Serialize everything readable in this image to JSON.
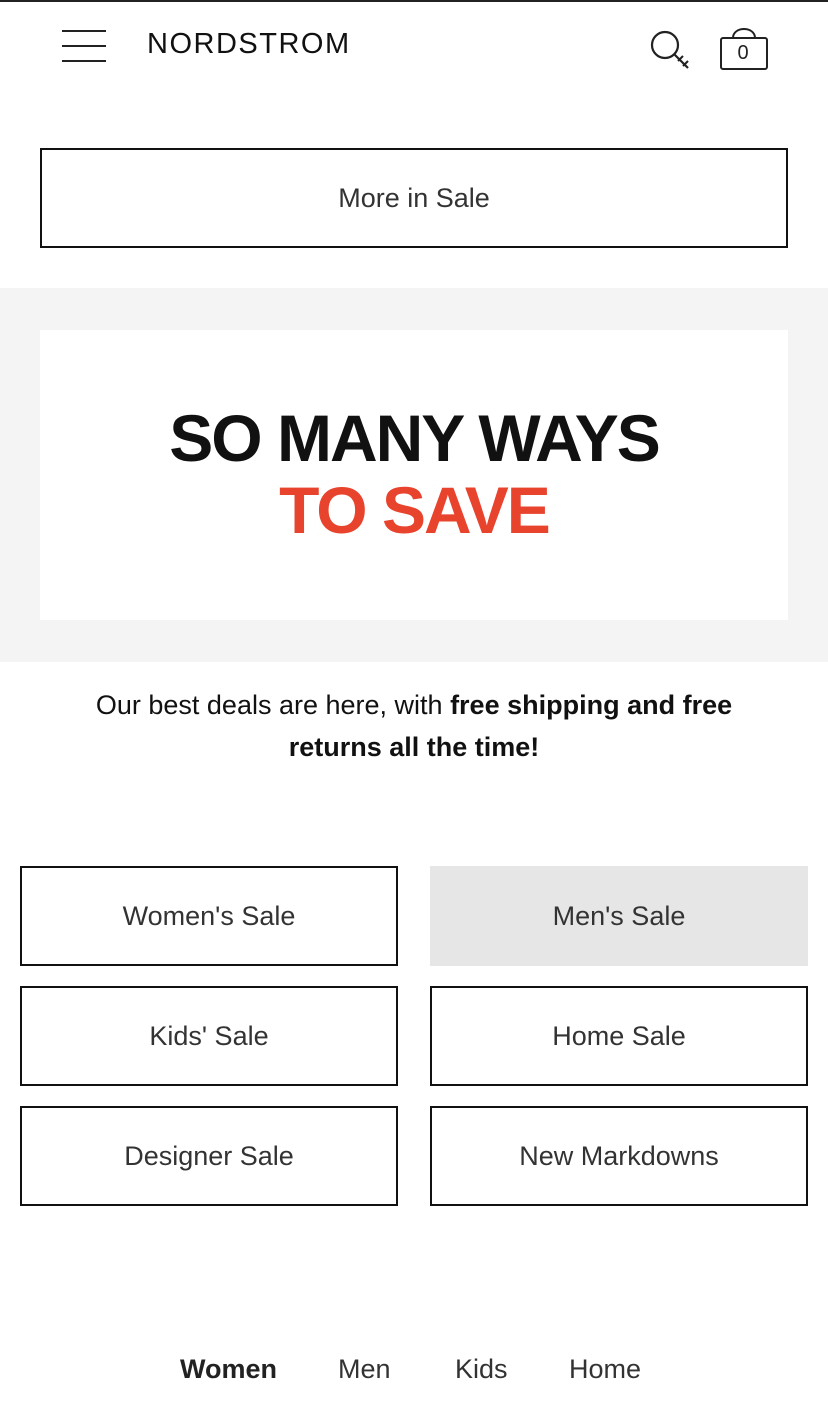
{
  "header": {
    "logo": "NORDSTROM",
    "bag_count": "0",
    "icons": [
      "hamburger-menu-icon",
      "search-icon",
      "shopping-bag-icon"
    ]
  },
  "more_button": {
    "label": "More in Sale"
  },
  "banner": {
    "line1": "SO MANY WAYS",
    "line2": "TO SAVE",
    "line1_color": "#111111",
    "line2_color": "#e8432d"
  },
  "promo": {
    "text_regular": "Our best deals are here, with ",
    "text_bold": "free shipping and free returns all the time!"
  },
  "categories": [
    {
      "label": "Women's Sale",
      "selected": false
    },
    {
      "label": "Men's Sale",
      "selected": true
    },
    {
      "label": "Kids' Sale",
      "selected": false
    },
    {
      "label": "Home Sale",
      "selected": false
    },
    {
      "label": "Designer Sale",
      "selected": false
    },
    {
      "label": "New Markdowns",
      "selected": false
    }
  ],
  "bottom_nav": [
    {
      "label": "Women",
      "active": true
    },
    {
      "label": "Men",
      "active": false
    },
    {
      "label": "Kids",
      "active": false
    },
    {
      "label": "Home",
      "active": false
    }
  ],
  "colors": {
    "accent_red": "#e8432d",
    "banner_background": "#f4f4f4",
    "selected_button_background": "#e6e6e6"
  }
}
